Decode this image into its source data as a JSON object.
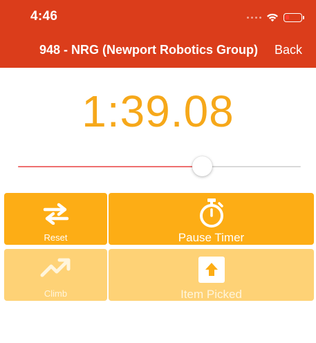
{
  "status_bar": {
    "time": "4:46",
    "battery_level": 0.15
  },
  "nav": {
    "title": "948 - NRG (Newport Robotics Group)",
    "back_label": "Back"
  },
  "timer": {
    "display": "1:39.08"
  },
  "slider": {
    "value": 0.65
  },
  "buttons": {
    "reset": {
      "label": "Reset",
      "icon": "swap-arrows-icon",
      "enabled": true
    },
    "pause": {
      "label": "Pause Timer",
      "icon": "stopwatch-icon",
      "enabled": true
    },
    "climb": {
      "label": "Climb",
      "icon": "trending-up-icon",
      "enabled": false
    },
    "item_picked": {
      "label": "Item Picked",
      "icon": "upload-arrow-icon",
      "enabled": false
    }
  },
  "colors": {
    "header": "#db3d1b",
    "accent": "#f6a81a",
    "button_active": "#fdad15",
    "button_disabled": "#fed276"
  }
}
